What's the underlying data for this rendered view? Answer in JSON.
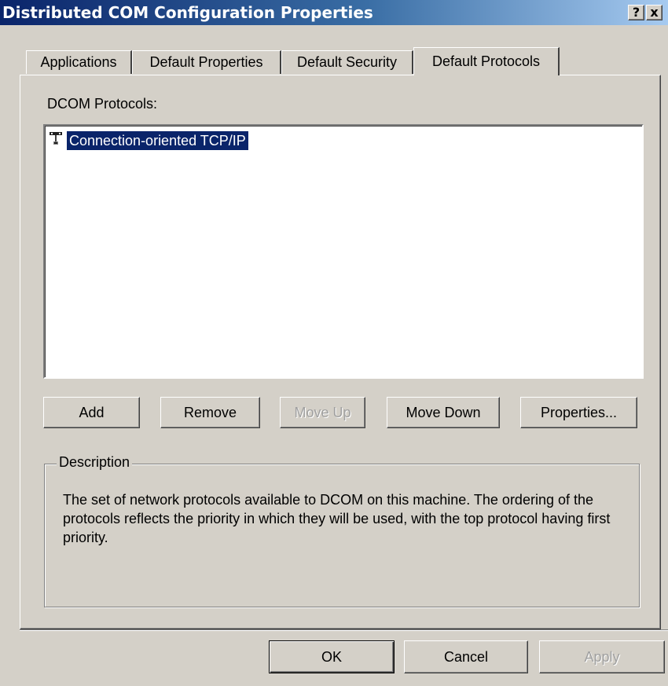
{
  "window": {
    "title": "Distributed COM Configuration Properties",
    "help_label": "?",
    "close_label": "x"
  },
  "tabs": [
    {
      "label": "Applications",
      "active": false
    },
    {
      "label": "Default Properties",
      "active": false
    },
    {
      "label": "Default Security",
      "active": false
    },
    {
      "label": "Default Protocols",
      "active": true
    }
  ],
  "protocols": {
    "label": "DCOM Protocols:",
    "items": [
      {
        "label": "Connection-oriented TCP/IP",
        "selected": true,
        "icon": "network-protocol-icon"
      }
    ]
  },
  "buttons": {
    "add": "Add",
    "remove": "Remove",
    "move_up": "Move Up",
    "move_down": "Move Down",
    "properties": "Properties..."
  },
  "description": {
    "legend": "Description",
    "text": "The set of network protocols available to DCOM on this machine. The ordering of the protocols reflects the priority in which they will be used, with the top protocol having first priority."
  },
  "footer": {
    "ok": "OK",
    "cancel": "Cancel",
    "apply": "Apply"
  },
  "colors": {
    "dialog_bg": "#d4d0c8",
    "title_gradient_start": "#0a246a",
    "title_gradient_end": "#a6caf0",
    "selection_bg": "#0a246a",
    "disabled_text": "#a0a0a0"
  }
}
